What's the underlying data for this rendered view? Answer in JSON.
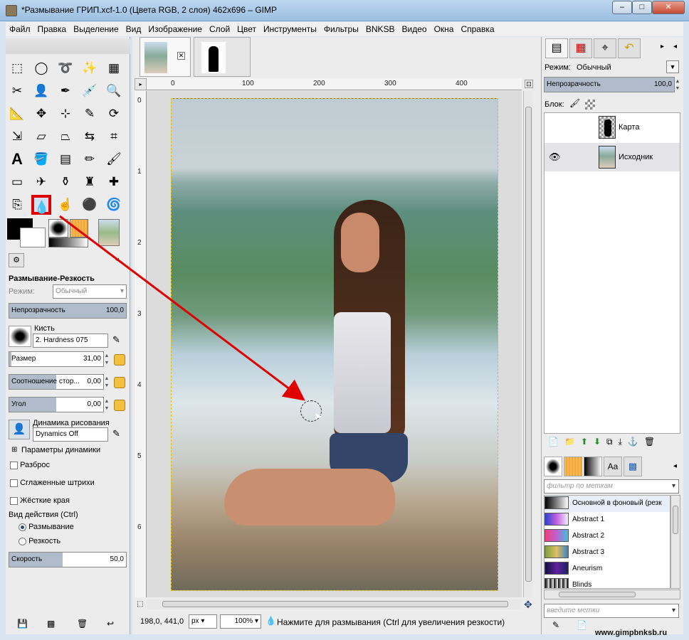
{
  "window": {
    "title": "*Размывание ГРИП.xcf-1.0 (Цвета RGB, 2 слоя) 462x696 – GIMP",
    "close_glyph": "✕",
    "max_glyph": "□",
    "min_glyph": "–"
  },
  "menu": [
    "Файл",
    "Правка",
    "Выделение",
    "Вид",
    "Изображение",
    "Слой",
    "Цвет",
    "Инструменты",
    "Фильтры",
    "BNKSB",
    "Видео",
    "Окна",
    "Справка"
  ],
  "tool_options": {
    "title": "Размывание-Резкость",
    "mode_label": "Режим:",
    "mode_value": "Обычный",
    "opacity_label": "Непрозрачность",
    "opacity_value": "100,0",
    "opacity_fraction": 1.0,
    "brush_label": "Кисть",
    "brush_value": "2. Hardness 075",
    "size_label": "Размер",
    "size_value": "31,00",
    "ratio_label": "Соотношение стор...",
    "ratio_value": "0,00",
    "angle_label": "Угол",
    "angle_value": "0,00",
    "dynamics_label": "Динамика рисования",
    "dynamics_value": "Dynamics Off",
    "dynamics_params": "Параметры динамики",
    "scatter": "Разброс",
    "smooth": "Сглаженные штрихи",
    "hard_edges": "Жёсткие края",
    "action_label": "Вид действия  (Ctrl)",
    "action_blur": "Размывание",
    "action_sharpen": "Резкость",
    "rate_label": "Скорость",
    "rate_value": "50,0",
    "rate_fraction": 0.5
  },
  "rulers": {
    "top": [
      "0",
      "100",
      "200",
      "300",
      "400"
    ],
    "left": [
      "0",
      "1",
      "2",
      "3",
      "4",
      "5",
      "6"
    ]
  },
  "status": {
    "coords": "198,0, 441,0",
    "unit": "px",
    "zoom": "100%",
    "message": "Нажмите для размывания (Ctrl для увеличения резкости)"
  },
  "layers": {
    "mode_label": "Режим:",
    "mode_value": "Обычный",
    "opacity_label": "Непрозрачность",
    "opacity_value": "100,0",
    "lock_label": "Блок:",
    "items": [
      {
        "name": "Карта"
      },
      {
        "name": "Исходник"
      }
    ]
  },
  "gradients": {
    "filter_placeholder": "фильтр по меткам",
    "items": [
      "Основной в фоновый (резк",
      "Abstract 1",
      "Abstract 2",
      "Abstract 3",
      "Aneurism",
      "Blinds"
    ],
    "tags_placeholder": "введите метки"
  },
  "watermark": "www.gimpbnksb.ru",
  "colors": {
    "highlight": "#e00000",
    "selection": "#cfe0f4"
  }
}
